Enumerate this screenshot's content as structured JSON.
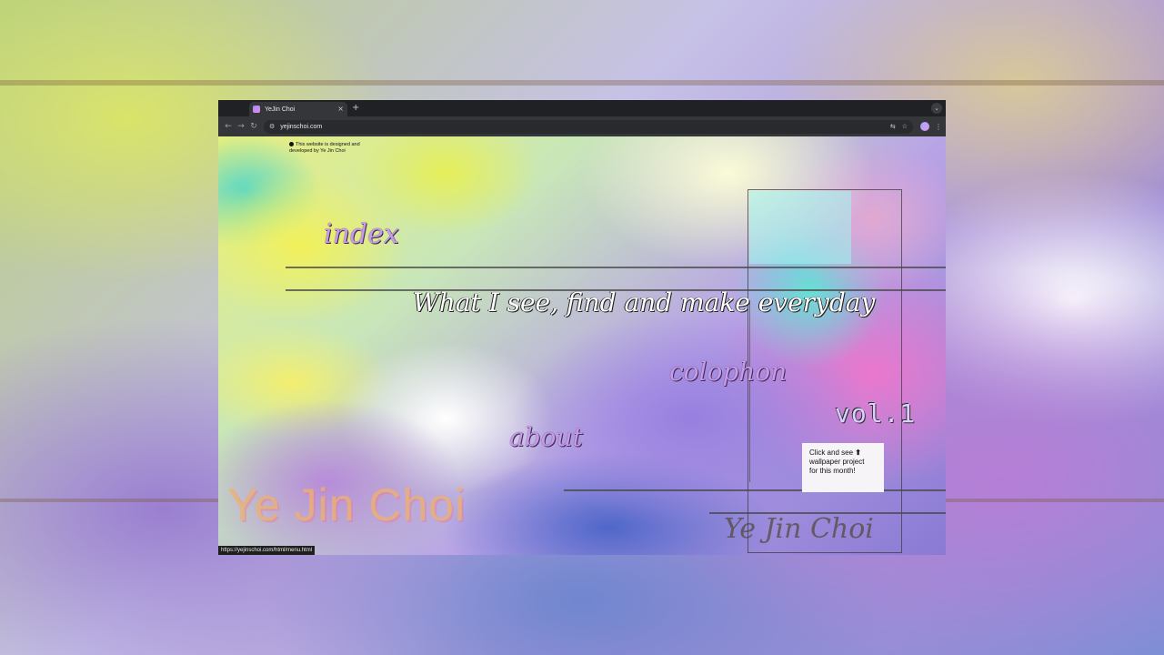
{
  "browser": {
    "tab": {
      "title": "YeJin Choi",
      "close_icon": "×"
    },
    "new_tab_icon": "+",
    "tab_search_icon": "⌄",
    "nav": {
      "back": "←",
      "forward": "→",
      "reload": "↻"
    },
    "url": "yejinschoi.com",
    "site_info_icon": "⚙",
    "translate_icon": "⇆",
    "bookmark_icon": "☆",
    "menu_icon": "⋮",
    "status_url": "https://yejinschoi.com/html/menu.html"
  },
  "page": {
    "credit": "This website is designed and developed by Ye Jin Choi",
    "menu": {
      "index": "index",
      "colophon": "colophon",
      "about": "about"
    },
    "tagline": "What I see, find and make everyday",
    "volume": "vol.1",
    "wallpaper_note": {
      "line1": "Click and see",
      "arrow": "⬆",
      "line2": "wallpaper project",
      "line3": "for this month!"
    },
    "big_name": "Ye Jin Choi",
    "scribble": "Ye Jin Choi",
    "colors": {
      "menu_link": "#c99ae7",
      "tagline": "#ffffff",
      "chrome_dark": "#202124",
      "chrome_toolbar": "#35363a"
    }
  }
}
